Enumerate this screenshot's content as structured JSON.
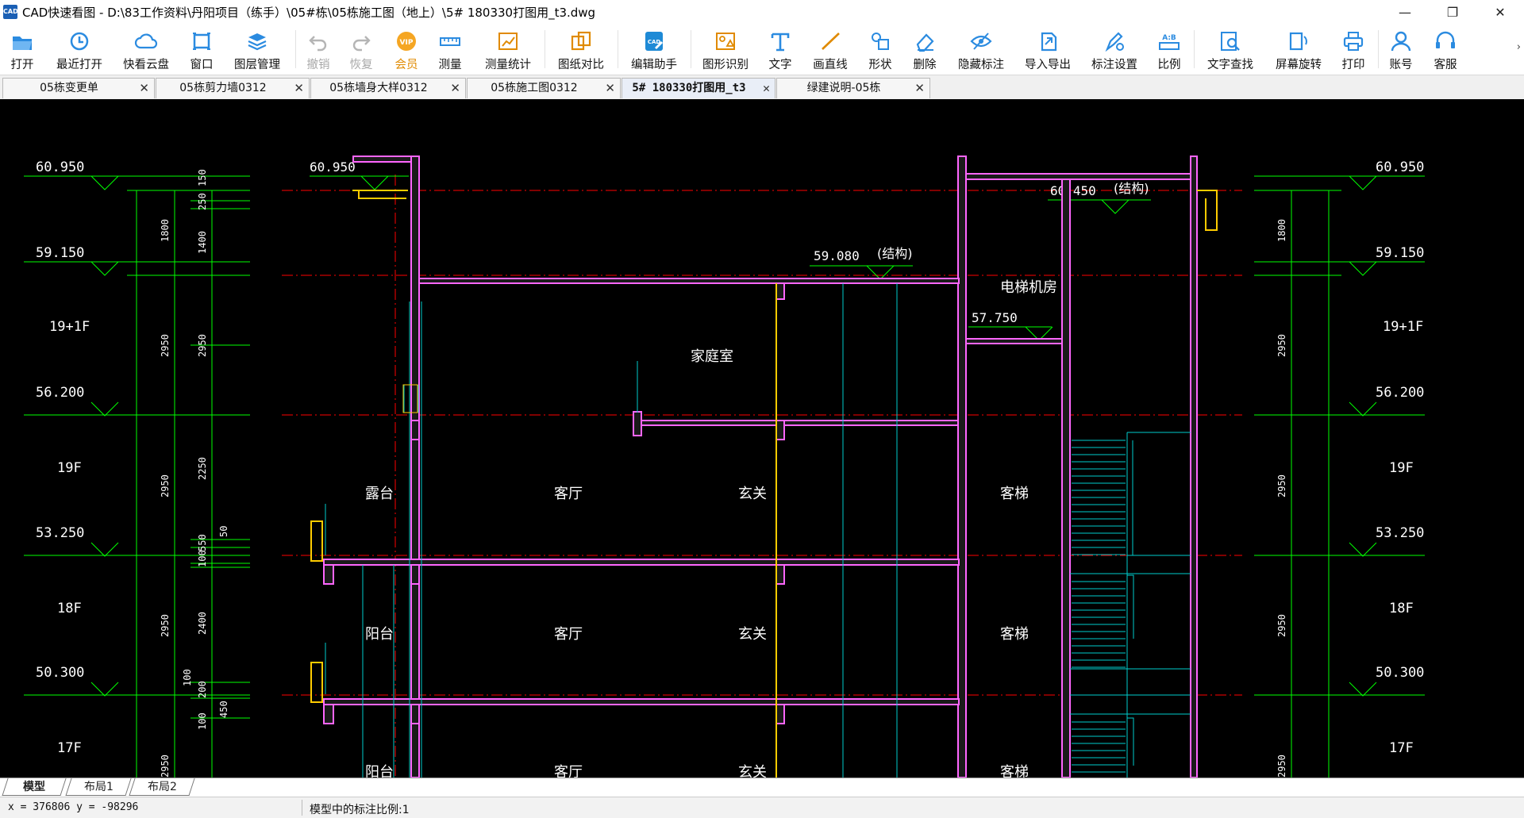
{
  "window": {
    "title": "CAD快速看图 - D:\\83工作资料\\丹阳项目（练手）\\05#栋\\05栋施工图（地上）\\5# 180330打图用_t3.dwg",
    "app_icon_text": "CAD",
    "min_glyph": "—",
    "restore_glyph": "❐",
    "close_glyph": "✕"
  },
  "toolbar": {
    "open": "打开",
    "recent": "最近打开",
    "cloud": "快看云盘",
    "window": "窗口",
    "layers": "图层管理",
    "undo": "撤销",
    "redo": "恢复",
    "vip": "会员",
    "measure": "测量",
    "measure_stats": "测量统计",
    "compare": "图纸对比",
    "edit_helper": "编辑助手",
    "shape_recog": "图形识别",
    "text": "文字",
    "line": "画直线",
    "shape": "形状",
    "delete": "删除",
    "hide_dims": "隐藏标注",
    "import_export": "导入导出",
    "dim_settings": "标注设置",
    "ratio": "比例",
    "text_search": "文字查找",
    "rotate": "屏幕旋转",
    "print": "打印",
    "account": "账号",
    "service": "客服",
    "more": "›"
  },
  "tabs": [
    {
      "label": "05栋变更单",
      "active": false
    },
    {
      "label": "05栋剪力墙0312",
      "active": false
    },
    {
      "label": "05栋墙身大样0312",
      "active": false
    },
    {
      "label": "05栋施工图0312",
      "active": false
    },
    {
      "label": "5# 180330打图用_t3",
      "active": true
    },
    {
      "label": "绿建说明-05栋",
      "active": false
    }
  ],
  "tab_close_glyph": "✕",
  "drawing": {
    "elev_left": [
      "60.950",
      "59.150",
      "56.200",
      "53.250",
      "50.300"
    ],
    "elev_right": [
      "60.950",
      "59.150",
      "56.200",
      "53.250",
      "50.300"
    ],
    "elev_mid_60950": "60.950",
    "elev_60450": "60.450",
    "elev_59080": "59.080",
    "elev_57750": "57.750",
    "struct_note": "(结构)",
    "floors_left": [
      "19+1F",
      "19F",
      "18F",
      "17F"
    ],
    "floors_right": [
      "19+1F",
      "19F",
      "18F",
      "17F"
    ],
    "dims_outer": [
      "1800",
      "2950",
      "2950",
      "2950",
      "2950"
    ],
    "dims_inner": [
      "150",
      "250",
      "1400",
      "2950",
      "2250",
      "50",
      "550",
      "100",
      "2400",
      "100",
      "200",
      "450",
      "100"
    ],
    "dims_right": [
      "1800",
      "2950",
      "2950",
      "2950",
      "2950"
    ],
    "rooms": {
      "family_room": "家庭室",
      "elevator_room": "电梯机房",
      "terrace": "露台",
      "balcony": "阳台",
      "living": "客厅",
      "living2": "客厅",
      "entrance": "玄关",
      "entrance2": "玄关",
      "stair": "客梯",
      "stair2": "客梯",
      "balcony_cut": "阳台",
      "living_cut": "客厅",
      "entrance_cut": "玄关",
      "stair_cut": "客梯"
    }
  },
  "layout_tabs": [
    "模型",
    "布局1",
    "布局2"
  ],
  "status": {
    "coords": "x = 376806  y = -98296",
    "scale": "模型中的标注比例:1"
  },
  "colors": {
    "canvas_bg": "#000000",
    "dim_green": "#00ff00",
    "wall_pink": "#ff66ff",
    "axis_red": "#ff0000",
    "stair_cyan": "#00cccc",
    "toolbar_blue": "#1e8ad6"
  }
}
